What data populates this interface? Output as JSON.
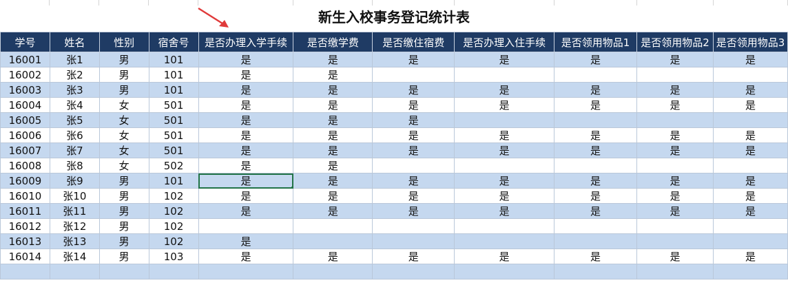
{
  "title": "新生入校事务登记统计表",
  "headers": [
    "学号",
    "姓名",
    "性别",
    "宿舍号",
    "是否办理入学手续",
    "是否缴学费",
    "是否缴住宿费",
    "是否办理入住手续",
    "是否领用物品1",
    "是否领用物品2",
    "是否领用物品3"
  ],
  "rows": [
    [
      "16001",
      "张1",
      "男",
      "101",
      "是",
      "是",
      "是",
      "是",
      "是",
      "是",
      "是"
    ],
    [
      "16002",
      "张2",
      "男",
      "101",
      "是",
      "是",
      "",
      "",
      "",
      "",
      ""
    ],
    [
      "16003",
      "张3",
      "男",
      "101",
      "是",
      "是",
      "是",
      "是",
      "是",
      "是",
      "是"
    ],
    [
      "16004",
      "张4",
      "女",
      "501",
      "是",
      "是",
      "是",
      "是",
      "是",
      "是",
      "是"
    ],
    [
      "16005",
      "张5",
      "女",
      "501",
      "是",
      "是",
      "是",
      "",
      "",
      "",
      ""
    ],
    [
      "16006",
      "张6",
      "女",
      "501",
      "是",
      "是",
      "是",
      "是",
      "是",
      "是",
      "是"
    ],
    [
      "16007",
      "张7",
      "女",
      "501",
      "是",
      "是",
      "是",
      "是",
      "是",
      "是",
      "是"
    ],
    [
      "16008",
      "张8",
      "女",
      "502",
      "是",
      "是",
      "",
      "",
      "",
      "",
      ""
    ],
    [
      "16009",
      "张9",
      "男",
      "101",
      "是",
      "是",
      "是",
      "是",
      "是",
      "是",
      "是"
    ],
    [
      "16010",
      "张10",
      "男",
      "102",
      "是",
      "是",
      "是",
      "是",
      "是",
      "是",
      "是"
    ],
    [
      "16011",
      "张11",
      "男",
      "102",
      "是",
      "是",
      "是",
      "是",
      "是",
      "是",
      "是"
    ],
    [
      "16012",
      "张12",
      "男",
      "102",
      "",
      "",
      "",
      "",
      "",
      "",
      ""
    ],
    [
      "16013",
      "张13",
      "男",
      "102",
      "是",
      "",
      "",
      "",
      "",
      "",
      ""
    ],
    [
      "16014",
      "张14",
      "男",
      "103",
      "是",
      "是",
      "是",
      "是",
      "是",
      "是",
      "是"
    ],
    [
      "",
      "",
      "",
      "",
      "",
      "",
      "",
      "",
      "",
      "",
      ""
    ]
  ],
  "selected_cell": {
    "row": 8,
    "col": 4
  },
  "colors": {
    "header_bg": "#1f3b64",
    "band": "#c5d8ef",
    "arrow": "#e03a3a",
    "selection": "#217346"
  }
}
